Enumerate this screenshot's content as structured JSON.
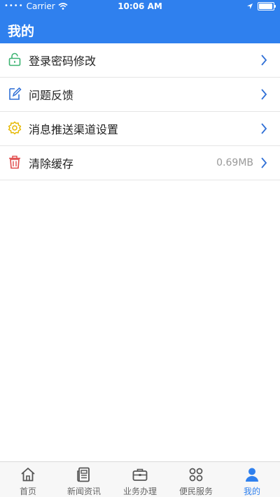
{
  "status_bar": {
    "carrier": "Carrier",
    "time": "10:06 AM"
  },
  "header": {
    "title": "我的"
  },
  "menu": [
    {
      "label": "登录密码修改",
      "value": "",
      "icon": "lock-icon",
      "icon_color": "#3cb371"
    },
    {
      "label": "问题反馈",
      "value": "",
      "icon": "edit-icon",
      "icon_color": "#2f6fd6"
    },
    {
      "label": "消息推送渠道设置",
      "value": "",
      "icon": "gear-icon",
      "icon_color": "#e6b800"
    },
    {
      "label": "清除缓存",
      "value": "0.69MB",
      "icon": "trash-icon",
      "icon_color": "#e14b4b"
    }
  ],
  "tabs": [
    {
      "label": "首页",
      "icon": "home-icon",
      "active": false
    },
    {
      "label": "新闻资讯",
      "icon": "news-icon",
      "active": false
    },
    {
      "label": "业务办理",
      "icon": "briefcase-icon",
      "active": false
    },
    {
      "label": "便民服务",
      "icon": "services-icon",
      "active": false
    },
    {
      "label": "我的",
      "icon": "user-icon",
      "active": true
    }
  ],
  "colors": {
    "accent": "#2f80ee",
    "chevron": "#2f6fd6"
  }
}
